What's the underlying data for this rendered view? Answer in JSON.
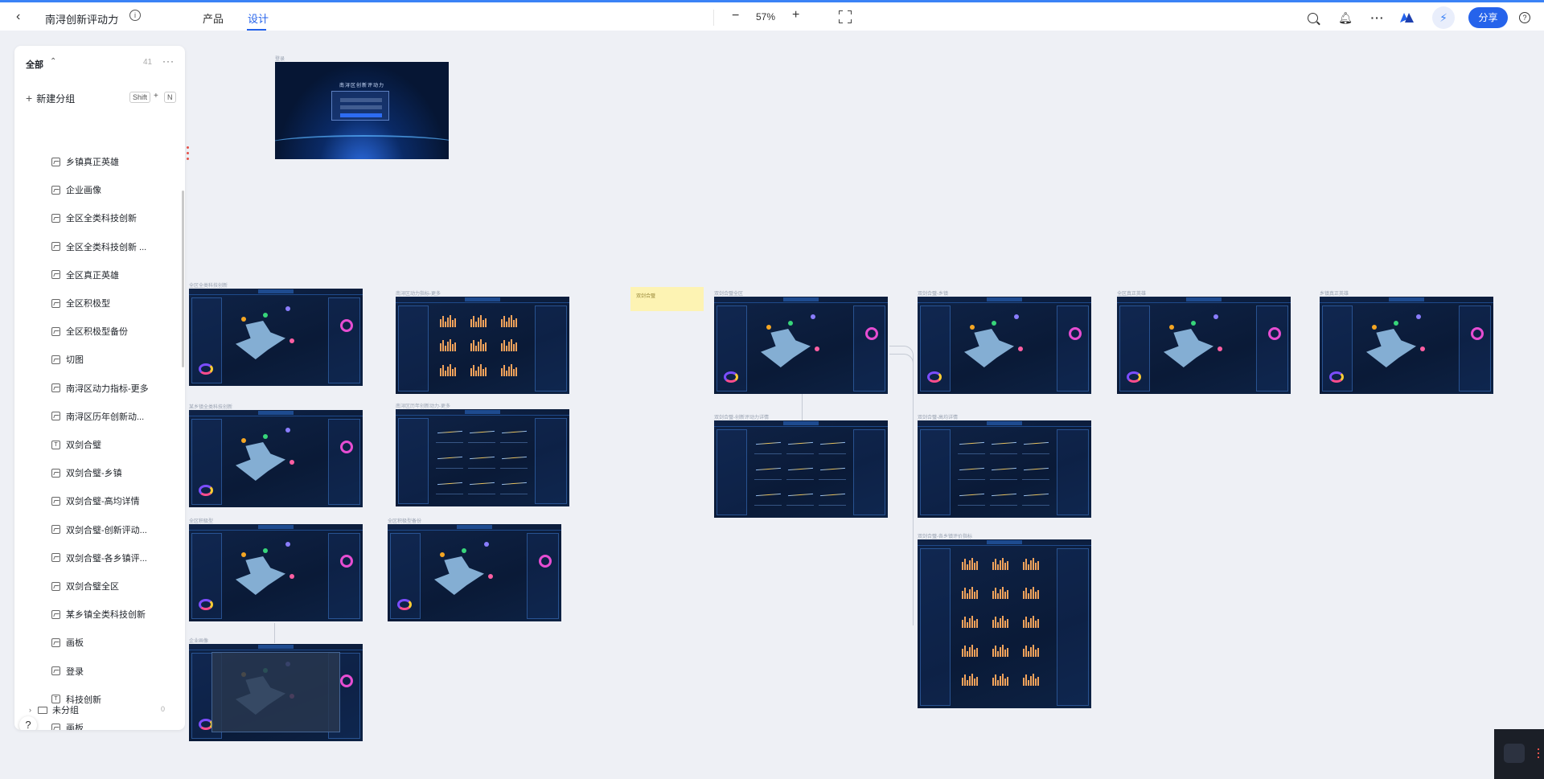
{
  "header": {
    "project_title": "南浔创新评动力",
    "tabs": [
      "产品",
      "设计"
    ],
    "active_tab": "设计",
    "zoom": "57%",
    "share_label": "分享",
    "accent_color": "#2563eb"
  },
  "sidebar": {
    "group_label": "全部",
    "count": "41",
    "new_group_label": "新建分组",
    "shortcut_shift": "Shift",
    "shortcut_plus": "+",
    "shortcut_key": "N",
    "items": [
      {
        "label": "乡镇真正英雄",
        "icon": "image-icon"
      },
      {
        "label": "企业画像",
        "icon": "image-icon"
      },
      {
        "label": "全区全类科技创新",
        "icon": "image-icon"
      },
      {
        "label": "全区全类科技创新 ...",
        "icon": "image-icon"
      },
      {
        "label": "全区真正英雄",
        "icon": "image-icon"
      },
      {
        "label": "全区积极型",
        "icon": "image-icon"
      },
      {
        "label": "全区积极型备份",
        "icon": "image-icon"
      },
      {
        "label": "切图",
        "icon": "image-icon"
      },
      {
        "label": "南浔区动力指标-更多",
        "icon": "image-icon"
      },
      {
        "label": "南浔区历年创新动...",
        "icon": "image-icon"
      },
      {
        "label": "双剑合璧",
        "icon": "text-icon"
      },
      {
        "label": "双剑合璧-乡镇",
        "icon": "image-icon"
      },
      {
        "label": "双剑合璧-高均详情",
        "icon": "image-icon"
      },
      {
        "label": "双剑合璧-创新评动...",
        "icon": "image-icon"
      },
      {
        "label": "双剑合璧-各乡镇评...",
        "icon": "image-icon"
      },
      {
        "label": "双剑合璧全区",
        "icon": "image-icon"
      },
      {
        "label": "某乡镇全类科技创新",
        "icon": "image-icon"
      },
      {
        "label": "画板",
        "icon": "image-icon"
      },
      {
        "label": "登录",
        "icon": "image-icon"
      },
      {
        "label": "科技创新",
        "icon": "text-icon"
      },
      {
        "label": "画板",
        "icon": "image-icon"
      }
    ],
    "ungrouped_label": "未分组",
    "ungrouped_count": "0"
  },
  "canvas": {
    "frames": [
      {
        "key": "login",
        "label": "登录",
        "kind": "login"
      },
      {
        "key": "f1",
        "label": "全区全类科技创新",
        "kind": "map"
      },
      {
        "key": "f2",
        "label": "南浔区动力指标-更多",
        "kind": "bars"
      },
      {
        "key": "f3",
        "label": "某乡镇全类科技创新",
        "kind": "map"
      },
      {
        "key": "f4",
        "label": "南浔区历年创新动力-更多",
        "kind": "lines"
      },
      {
        "key": "f5",
        "label": "全区积极型",
        "kind": "map"
      },
      {
        "key": "f6",
        "label": "全区积极型备份",
        "kind": "map"
      },
      {
        "key": "f7",
        "label": "企业画像",
        "kind": "modal"
      },
      {
        "key": "f8",
        "label": "双剑合璧全区",
        "kind": "map"
      },
      {
        "key": "f9",
        "label": "双剑合璧-乡镇",
        "kind": "map"
      },
      {
        "key": "f10",
        "label": "全区真正英雄",
        "kind": "map"
      },
      {
        "key": "f11",
        "label": "乡镇真正英雄",
        "kind": "map"
      },
      {
        "key": "f12",
        "label": "双剑合璧-创新评动力详情",
        "kind": "lines"
      },
      {
        "key": "f13",
        "label": "双剑合璧-高均详情",
        "kind": "lines"
      },
      {
        "key": "f14",
        "label": "双剑合璧-各乡镇评价指标",
        "kind": "bars"
      }
    ],
    "sticky_note": "双剑合璧",
    "login_title": "南浔区创新评动力"
  }
}
